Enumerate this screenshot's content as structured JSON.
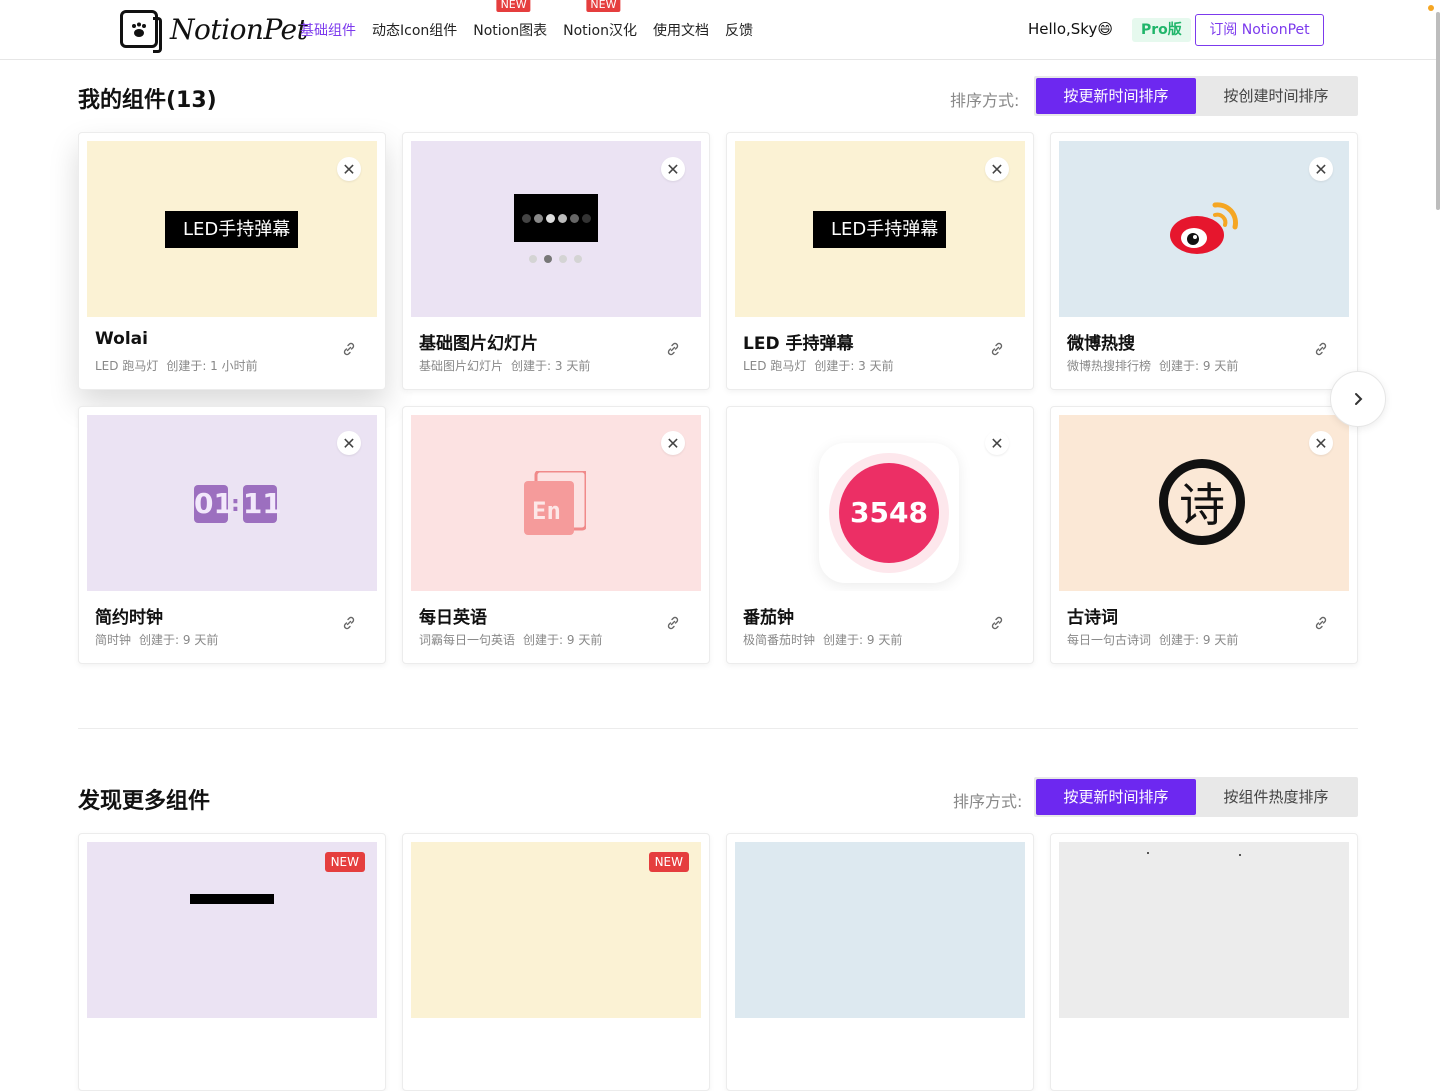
{
  "header": {
    "logo_text": "NotionPet",
    "nav": [
      {
        "label": "基础组件",
        "active": true,
        "badge": ""
      },
      {
        "label": "动态Icon组件",
        "active": false,
        "badge": ""
      },
      {
        "label": "Notion图表",
        "active": false,
        "badge": "NEW"
      },
      {
        "label": "Notion汉化",
        "active": false,
        "badge": "NEW"
      },
      {
        "label": "使用文档",
        "active": false,
        "badge": ""
      },
      {
        "label": "反馈",
        "active": false,
        "badge": ""
      }
    ],
    "greeting": "Hello,Sky😄",
    "pro_label": "Pro版",
    "subscribe_label": "订阅 NotionPet"
  },
  "my_widgets": {
    "title": "我的组件(13)",
    "sort_label": "排序方式:",
    "sort_options": [
      "按更新时间排序",
      "按创建时间排序"
    ],
    "cards": [
      {
        "title": "Wolai",
        "type": "LED 跑马灯",
        "created": "创建于: 1 小时前",
        "bg": "#fbf2d4",
        "thumb": "led",
        "thumb_text": "LED手持弹幕"
      },
      {
        "title": "基础图片幻灯片",
        "type": "基础图片幻灯片",
        "created": "创建于: 3 天前",
        "bg": "#ebe3f3",
        "thumb": "slides",
        "thumb_text": ""
      },
      {
        "title": "LED 手持弹幕",
        "type": "LED 跑马灯",
        "created": "创建于: 3 天前",
        "bg": "#fbf2d4",
        "thumb": "led",
        "thumb_text": "LED手持弹幕"
      },
      {
        "title": "微博热搜",
        "type": "微博热搜排行榜",
        "created": "创建于: 9 天前",
        "bg": "#dde9f0",
        "thumb": "weibo",
        "thumb_text": ""
      },
      {
        "title": "简约时钟",
        "type": "简时钟",
        "created": "创建于: 9 天前",
        "bg": "#ebe3f3",
        "thumb": "clock",
        "thumb_text": "01:11"
      },
      {
        "title": "每日英语",
        "type": "词霸每日一句英语",
        "created": "创建于: 9 天前",
        "bg": "#fce2e2",
        "thumb": "english",
        "thumb_text": "En"
      },
      {
        "title": "番茄钟",
        "type": "极简番茄时钟",
        "created": "创建于: 9 天前",
        "bg": "#ffffff",
        "thumb": "tomato",
        "thumb_text": "3548"
      },
      {
        "title": "古诗词",
        "type": "每日一句古诗词",
        "created": "创建于: 9 天前",
        "bg": "#fbe8d6",
        "thumb": "poem",
        "thumb_text": "诗"
      }
    ]
  },
  "discover": {
    "title": "发现更多组件",
    "sort_label": "排序方式:",
    "sort_options": [
      "按更新时间排序",
      "按组件热度排序"
    ],
    "cards": [
      {
        "bg": "#ebe3f3",
        "badge": "NEW"
      },
      {
        "bg": "#fbf2d4",
        "badge": "NEW"
      },
      {
        "bg": "#dde9f0",
        "badge": ""
      },
      {
        "bg": "#ececec",
        "badge": ""
      }
    ]
  },
  "colors": {
    "accent": "#6d28f0",
    "nav_active": "#7c3aed",
    "new_badge": "#e53e3e",
    "pro_green": "#20b56a"
  }
}
